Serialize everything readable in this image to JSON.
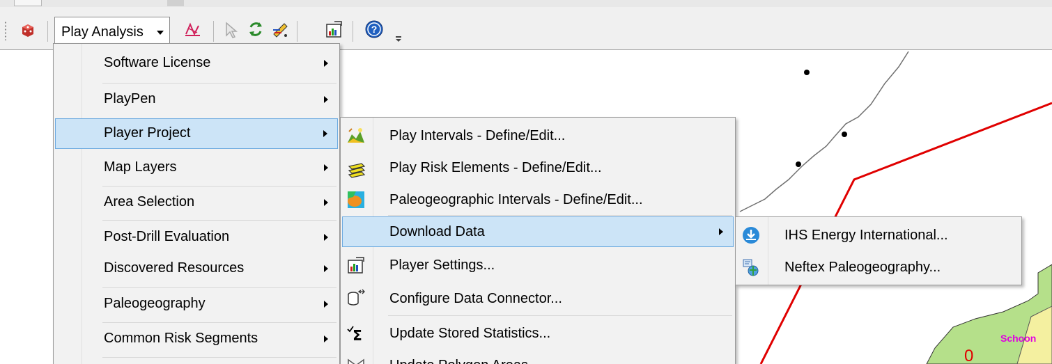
{
  "toolbar": {
    "play_analysis_label": "Play Analysis"
  },
  "menu_main": {
    "items": [
      {
        "label": "Software License",
        "has_submenu": true
      },
      {
        "label": "PlayPen",
        "has_submenu": true
      },
      {
        "label": "Player Project",
        "has_submenu": true,
        "highlighted": true
      },
      {
        "label": "Map Layers",
        "has_submenu": true
      },
      {
        "label": "Area Selection",
        "has_submenu": true
      },
      {
        "label": "Post-Drill Evaluation",
        "has_submenu": true
      },
      {
        "label": "Discovered Resources",
        "has_submenu": true
      },
      {
        "label": "Paleogeography",
        "has_submenu": true
      },
      {
        "label": "Common Risk Segments",
        "has_submenu": true
      }
    ]
  },
  "menu_player_project": {
    "items": [
      {
        "label": "Play Intervals - Define/Edit...",
        "icon": "play-intervals-icon"
      },
      {
        "label": "Play Risk Elements - Define/Edit...",
        "icon": "risk-layers-icon"
      },
      {
        "label": "Paleogeographic Intervals - Define/Edit...",
        "icon": "paleogeography-icon"
      },
      {
        "label": "Download Data",
        "has_submenu": true,
        "highlighted": true
      },
      {
        "label": "Player Settings...",
        "icon": "settings-chart-icon"
      },
      {
        "label": "Configure Data Connector...",
        "icon": "database-connector-icon"
      },
      {
        "label": "Update Stored Statistics...",
        "icon": "sigma-icon"
      },
      {
        "label": "Update Polygon Areas",
        "icon": "polygon-icon"
      }
    ]
  },
  "menu_download_data": {
    "items": [
      {
        "label": "IHS Energy International...",
        "icon": "download-circle-icon"
      },
      {
        "label": "Neftex Paleogeography...",
        "icon": "neftex-icon"
      }
    ]
  },
  "map": {
    "labels": {
      "schoon": "Schoon",
      "zero": "0"
    }
  },
  "colors": {
    "menu_bg": "#f2f2f2",
    "highlight_bg": "#cce4f7",
    "highlight_border": "#6caae0",
    "map_boundary": "#e00000",
    "map_polygon_fill": "#b5e08a"
  }
}
